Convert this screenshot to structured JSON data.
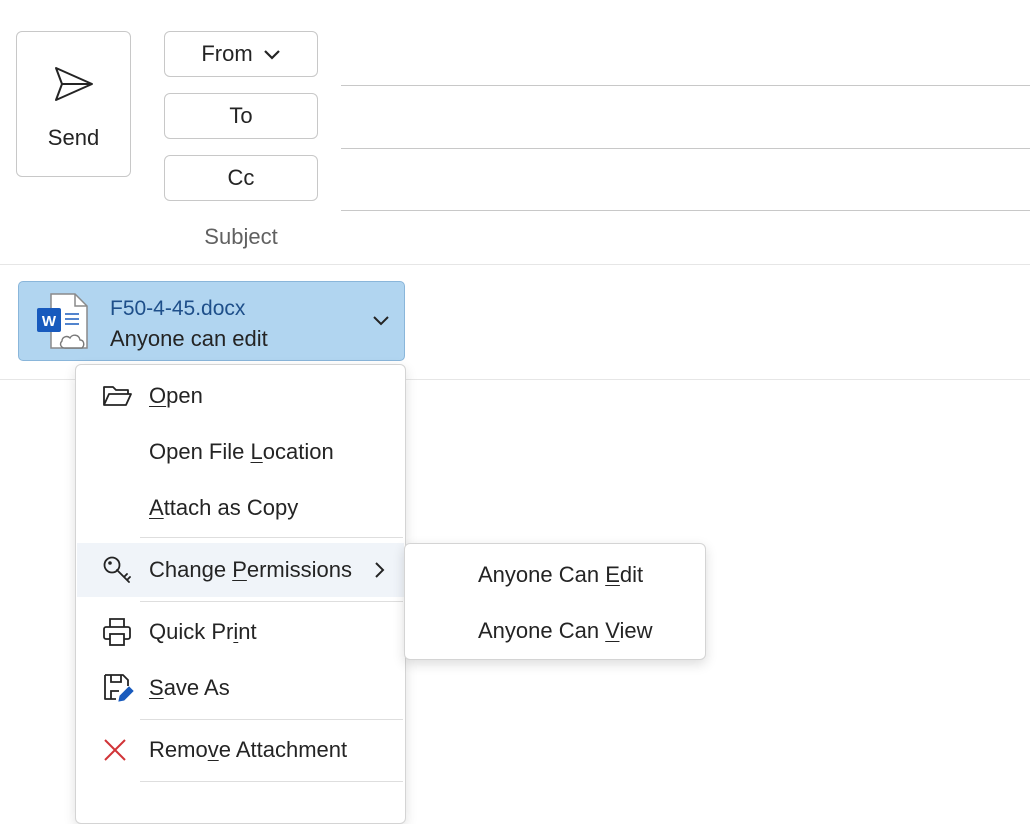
{
  "compose": {
    "send_label": "Send",
    "from_label": "From",
    "to_label": "To",
    "cc_label": "Cc",
    "subject_label": "Subject"
  },
  "attachment": {
    "file_name": "F50-4-45.docx",
    "permission": "Anyone can edit",
    "icon": "word-cloud-icon",
    "chip_color": "#b1d5f0"
  },
  "context_menu": {
    "open": {
      "pre": "",
      "key": "O",
      "post": "pen"
    },
    "open_location": {
      "pre": "Open File ",
      "key": "L",
      "post": "ocation"
    },
    "attach_copy": {
      "pre": "",
      "key": "A",
      "post": "ttach as Copy"
    },
    "change_permissions": {
      "pre": "Change ",
      "key": "P",
      "post": "ermissions"
    },
    "quick_print": {
      "pre": "Quick Pr",
      "key": "i",
      "post": "nt"
    },
    "save_as": {
      "pre": "",
      "key": "S",
      "post": "ave As"
    },
    "remove": {
      "pre": "Remo",
      "key": "v",
      "post": "e Attachment"
    }
  },
  "permissions_submenu": {
    "edit": {
      "pre": "Anyone Can ",
      "key": "E",
      "post": "dit"
    },
    "view": {
      "pre": "Anyone Can ",
      "key": "V",
      "post": "iew"
    }
  },
  "colors": {
    "remove_icon": "#d13438",
    "accent_blue": "#185abd"
  }
}
